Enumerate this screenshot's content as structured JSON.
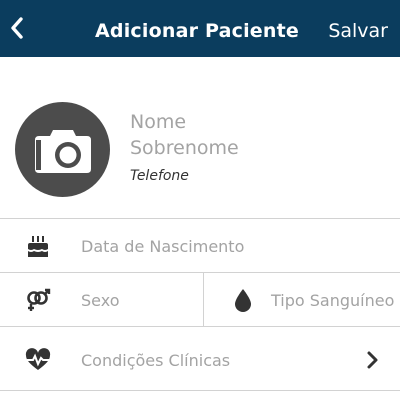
{
  "header": {
    "back_icon": "chevron-left-icon",
    "title": "Adicionar Paciente",
    "save_label": "Salvar",
    "background": "#0b3d5e"
  },
  "profile": {
    "photo_icon": "camera-icon",
    "first_name_placeholder": "Nome",
    "last_name_placeholder": "Sobrenome",
    "phone_placeholder": "Telefone"
  },
  "fields": {
    "birth_date": {
      "label": "Data de Nascimento",
      "icon": "birthday-cake-icon"
    },
    "sex": {
      "label": "Sexo",
      "icon": "gender-icon"
    },
    "blood_type": {
      "label": "Tipo Sanguíneo",
      "icon": "blood-drop-icon"
    },
    "conditions": {
      "label": "Condições Clínicas",
      "icon": "heart-pulse-icon",
      "chevron_icon": "chevron-right-icon"
    }
  }
}
